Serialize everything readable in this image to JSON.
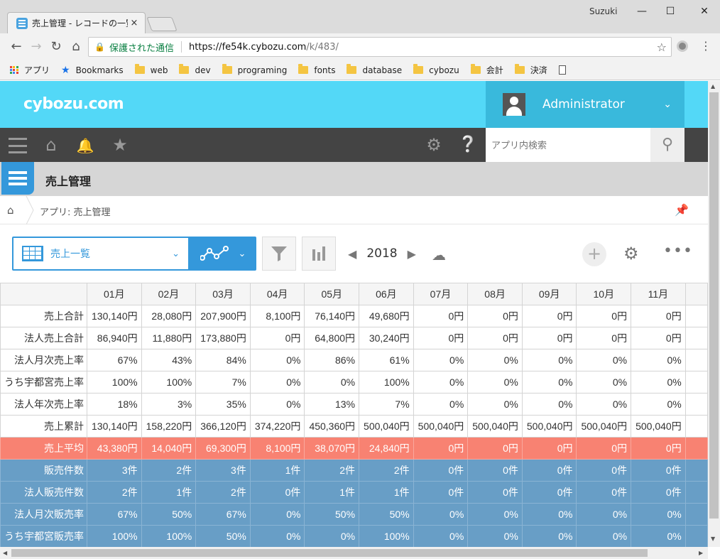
{
  "browser": {
    "tab_title": "売上管理 - レコードの一覧",
    "tab_close": "×",
    "user": "Suzuki",
    "win_minimize": "—",
    "win_maximize": "☐",
    "win_close": "✕",
    "secure_label": "保護された通信",
    "url_host": "https://fe54k.cybozu.com",
    "url_path": "/k/483/",
    "bookmarks": [
      {
        "label": "アプリ",
        "icon": "apps-grid-icon"
      },
      {
        "label": "Bookmarks",
        "icon": "star-icon"
      },
      {
        "label": "web",
        "icon": "folder-icon"
      },
      {
        "label": "dev",
        "icon": "folder-icon"
      },
      {
        "label": "programing",
        "icon": "folder-icon"
      },
      {
        "label": "fonts",
        "icon": "folder-icon"
      },
      {
        "label": "database",
        "icon": "folder-icon"
      },
      {
        "label": "cybozu",
        "icon": "folder-icon"
      },
      {
        "label": "会計",
        "icon": "folder-icon"
      },
      {
        "label": "決済",
        "icon": "folder-icon"
      },
      {
        "label": "",
        "icon": "document-icon"
      }
    ]
  },
  "app": {
    "logo": "cybozu.com",
    "user_name": "Administrator",
    "search_placeholder": "アプリ内検索",
    "app_title": "売上管理",
    "breadcrumb": "アプリ: 売上管理",
    "view_name": "売上一覧",
    "year": "2018",
    "colors": {
      "header": "#53d8f7",
      "accent": "#3498db",
      "avg_row": "#f88272",
      "blue_row": "#689ec6"
    }
  },
  "table": {
    "columns": [
      "",
      "01月",
      "02月",
      "03月",
      "04月",
      "05月",
      "06月",
      "07月",
      "08月",
      "09月",
      "10月",
      "11月"
    ],
    "rows": [
      {
        "label": "売上合計",
        "style": "plain",
        "values": [
          "130,140円",
          "28,080円",
          "207,900円",
          "8,100円",
          "76,140円",
          "49,680円",
          "0円",
          "0円",
          "0円",
          "0円",
          "0円"
        ]
      },
      {
        "label": "法人売上合計",
        "style": "plain",
        "values": [
          "86,940円",
          "11,880円",
          "173,880円",
          "0円",
          "64,800円",
          "30,240円",
          "0円",
          "0円",
          "0円",
          "0円",
          "0円"
        ]
      },
      {
        "label": "法人月次売上率",
        "style": "plain",
        "values": [
          "67%",
          "43%",
          "84%",
          "0%",
          "86%",
          "61%",
          "0%",
          "0%",
          "0%",
          "0%",
          "0%"
        ]
      },
      {
        "label": "うち宇都宮売上率",
        "style": "plain",
        "values": [
          "100%",
          "100%",
          "7%",
          "0%",
          "0%",
          "100%",
          "0%",
          "0%",
          "0%",
          "0%",
          "0%"
        ]
      },
      {
        "label": "法人年次売上率",
        "style": "plain",
        "values": [
          "18%",
          "3%",
          "35%",
          "0%",
          "13%",
          "7%",
          "0%",
          "0%",
          "0%",
          "0%",
          "0%"
        ]
      },
      {
        "label": "売上累計",
        "style": "plain",
        "values": [
          "130,140円",
          "158,220円",
          "366,120円",
          "374,220円",
          "450,360円",
          "500,040円",
          "500,040円",
          "500,040円",
          "500,040円",
          "500,040円",
          "500,040円"
        ]
      },
      {
        "label": "売上平均",
        "style": "avg",
        "values": [
          "43,380円",
          "14,040円",
          "69,300円",
          "8,100円",
          "38,070円",
          "24,840円",
          "0円",
          "0円",
          "0円",
          "0円",
          "0円"
        ]
      },
      {
        "label": "販売件数",
        "style": "blue",
        "values": [
          "3件",
          "2件",
          "3件",
          "1件",
          "2件",
          "2件",
          "0件",
          "0件",
          "0件",
          "0件",
          "0件"
        ]
      },
      {
        "label": "法人販売件数",
        "style": "blue",
        "values": [
          "2件",
          "1件",
          "2件",
          "0件",
          "1件",
          "1件",
          "0件",
          "0件",
          "0件",
          "0件",
          "0件"
        ]
      },
      {
        "label": "法人月次販売率",
        "style": "blue",
        "values": [
          "67%",
          "50%",
          "67%",
          "0%",
          "50%",
          "50%",
          "0%",
          "0%",
          "0%",
          "0%",
          "0%"
        ]
      },
      {
        "label": "うち宇都宮販売率",
        "style": "blue",
        "values": [
          "100%",
          "100%",
          "50%",
          "0%",
          "0%",
          "100%",
          "0%",
          "0%",
          "0%",
          "0%",
          "0%"
        ]
      }
    ]
  }
}
